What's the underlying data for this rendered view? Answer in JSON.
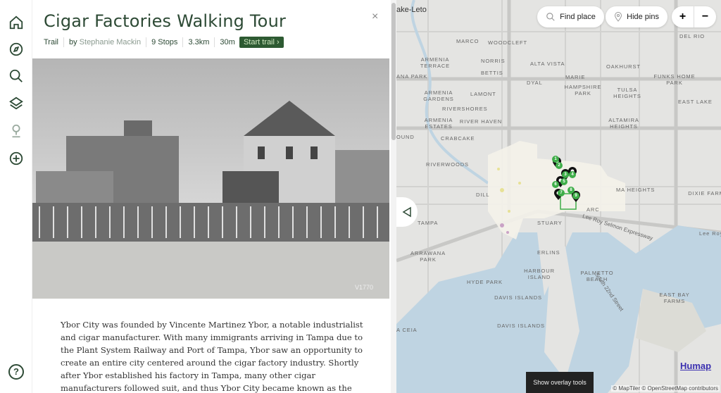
{
  "sidebar": {
    "items": [
      {
        "name": "home-icon"
      },
      {
        "name": "compass-icon"
      },
      {
        "name": "search-icon"
      },
      {
        "name": "layers-icon"
      },
      {
        "name": "trail-pin-icon"
      },
      {
        "name": "add-icon"
      }
    ],
    "help": "?"
  },
  "panel": {
    "title": "Cigar Factories Walking Tour",
    "close": "×",
    "meta": {
      "type": "Trail",
      "by": "by",
      "author": "Stephanie Mackin",
      "stops": "9 Stops",
      "distance": "3.3km",
      "duration": "30m",
      "start": "Start trail ›"
    },
    "photo_caption": "V1770",
    "body": "Ybor City was founded by Vincente Martinez Ybor, a notable industrialist and cigar manufacturer. With many immigrants arriving in Tampa due to the Plant System Railway and Port of Tampa, Ybor saw an opportunity to create an entire city centered around the cigar factory industry. Shortly after Ybor established his factory in Tampa, many other cigar manufacturers followed suit, and thus Ybor City became known as the \"cigar capital of the world.\" Over time, hundreds"
  },
  "map": {
    "find_place": "Find place",
    "hide_pins": "Hide pins",
    "zoom_in": "+",
    "zoom_out": "−",
    "overlay_tools": "Show overlay tools",
    "attribution": "© MapTiler © OpenStreetMap contributors",
    "brand": "Humap",
    "labels": [
      "ake-Leto",
      "MARCO",
      "WOODCLEFT",
      "ARMENIA TERRACE",
      "NORRIS",
      "ALTA VISTA",
      "OAKHURST",
      "BETTIS",
      "ANA PARK",
      "MARIE",
      "DYAL",
      "HAMPSHIRE PARK",
      "TULSA HEIGHTS",
      "FUNKS HOME PARK",
      "ARMENIA GARDENS",
      "LAMONT",
      "RIVERSHORES",
      "ARMENIA ESTATES",
      "RIVER HAVEN",
      "ALTAMIRA HEIGHTS",
      "OUND",
      "CRABCAKE",
      "RIVERWOODS",
      "DILL",
      "MA HEIGHTS",
      "DIXIE FARMS",
      "TAMPA",
      "STUARY",
      "ARRAWANA PARK",
      "ERLINS",
      "HARBOUR ISLAND",
      "PALMETTO BEACH",
      "HYDE PARK",
      "DAVIS ISLANDS",
      "DAVIS ISLANDS",
      "EAST BAY FARMS",
      "A CEIA",
      "DEL RIO",
      "EAST LAKE",
      "Lee Roy Selmon Expressway",
      "South 22nd Street",
      "Lee Roy",
      "ARC"
    ],
    "pins": [
      "1",
      "2",
      "3",
      "4",
      "5",
      "6",
      "7",
      "8",
      "9"
    ],
    "accent": "#3fae49"
  }
}
